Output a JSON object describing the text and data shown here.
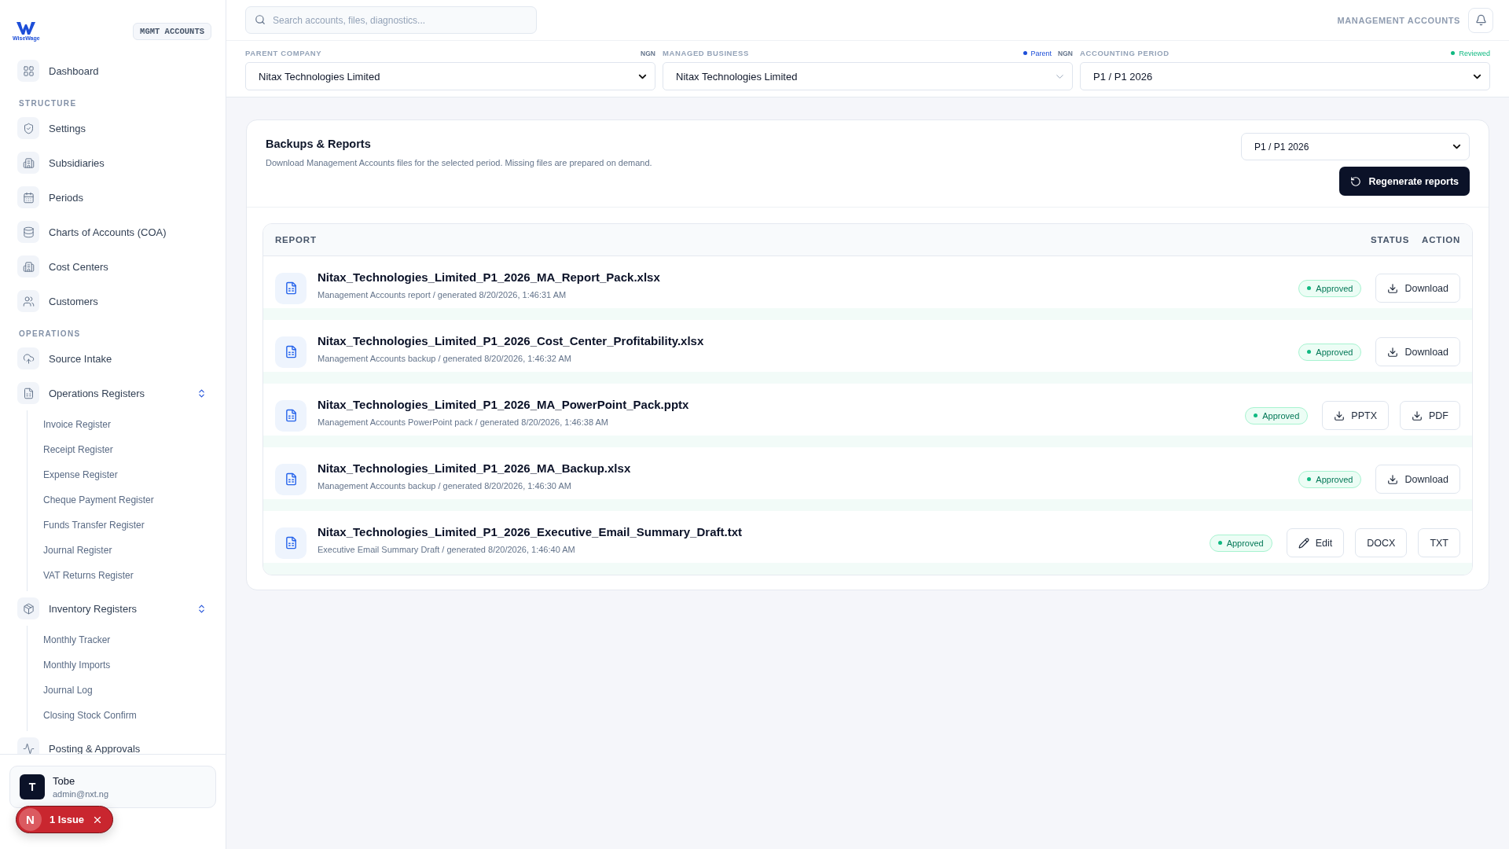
{
  "sidebar": {
    "brand": "WiseWage",
    "badge": "MGMT ACCOUNTS",
    "nav": [
      {
        "kind": "link",
        "label": "Dashboard"
      },
      {
        "kind": "heading",
        "label": "STRUCTURE"
      },
      {
        "kind": "link",
        "label": "Settings"
      },
      {
        "kind": "link",
        "label": "Subsidiaries"
      },
      {
        "kind": "link",
        "label": "Periods"
      },
      {
        "kind": "link",
        "label": "Charts of Accounts (COA)"
      },
      {
        "kind": "link",
        "label": "Cost Centers"
      },
      {
        "kind": "link",
        "label": "Customers"
      },
      {
        "kind": "heading",
        "label": "OPERATIONS"
      },
      {
        "kind": "link",
        "label": "Source Intake"
      },
      {
        "kind": "group",
        "label": "Operations Registers",
        "expanded": true,
        "children": [
          {
            "label": "Invoice Register"
          },
          {
            "label": "Receipt Register"
          },
          {
            "label": "Expense Register"
          },
          {
            "label": "Cheque Payment Register"
          },
          {
            "label": "Funds Transfer Register"
          },
          {
            "label": "Journal Register"
          },
          {
            "label": "VAT Returns Register"
          }
        ]
      },
      {
        "kind": "group",
        "label": "Inventory Registers",
        "expanded": true,
        "children": [
          {
            "label": "Monthly Tracker"
          },
          {
            "label": "Monthly Imports"
          },
          {
            "label": "Journal Log"
          },
          {
            "label": "Closing Stock Confirm"
          }
        ]
      },
      {
        "kind": "link",
        "label": "Posting & Approvals"
      }
    ],
    "user": {
      "initial": "T",
      "name": "Tobe",
      "email": "admin@nxt.ng"
    }
  },
  "toast": {
    "initial": "N",
    "label": "1 Issue"
  },
  "topbar": {
    "search": {
      "placeholder": "Search accounts, files, diagnostics..."
    },
    "title": "MANAGEMENT ACCOUNTS"
  },
  "selectors": [
    {
      "kind": "native",
      "label": "PARENT COMPANY",
      "tags": [
        {
          "text": "NGN"
        }
      ],
      "value": "Nitax Technologies Limited"
    },
    {
      "kind": "custom",
      "label": "MANAGED BUSINESS",
      "tags": [
        {
          "text": "Parent",
          "color": "#1d4ed8"
        },
        {
          "text": "NGN"
        }
      ],
      "value": "Nitax Technologies Limited"
    },
    {
      "kind": "native",
      "label": "ACCOUNTING PERIOD",
      "tags": [
        {
          "text": "Reviewed",
          "color": "#10b981"
        }
      ],
      "value": "P1 / P1 2026"
    }
  ],
  "backups": {
    "title": "Backups & Reports",
    "subtitle": "Download Management Accounts files for the selected period. Missing files are prepared on demand.",
    "period": "P1 / P1 2026",
    "regenerate": "Regenerate reports",
    "columns": [
      "REPORT",
      "STATUS",
      "ACTION"
    ],
    "rows": [
      {
        "name": "Nitax_Technologies_Limited_P1_2026_MA_Report_Pack.xlsx",
        "description": "Management Accounts report / generated 8/20/2026, 1:46:31 AM",
        "status": "Approved",
        "actions": [
          {
            "kind": "download",
            "label": "Download"
          }
        ]
      },
      {
        "name": "Nitax_Technologies_Limited_P1_2026_Cost_Center_Profitability.xlsx",
        "description": "Management Accounts backup / generated 8/20/2026, 1:46:32 AM",
        "status": "Approved",
        "actions": [
          {
            "kind": "download",
            "label": "Download"
          }
        ]
      },
      {
        "name": "Nitax_Technologies_Limited_P1_2026_MA_PowerPoint_Pack.pptx",
        "description": "Management Accounts PowerPoint pack / generated 8/20/2026, 1:46:38 AM",
        "status": "Approved",
        "actions": [
          {
            "kind": "download",
            "label": "PPTX"
          },
          {
            "kind": "download",
            "label": "PDF"
          }
        ]
      },
      {
        "name": "Nitax_Technologies_Limited_P1_2026_MA_Backup.xlsx",
        "description": "Management Accounts backup / generated 8/20/2026, 1:46:30 AM",
        "status": "Approved",
        "actions": [
          {
            "kind": "download",
            "label": "Download"
          }
        ]
      },
      {
        "name": "Nitax_Technologies_Limited_P1_2026_Executive_Email_Summary_Draft.txt",
        "description": "Executive Email Summary Draft / generated 8/20/2026, 1:46:40 AM",
        "status": "Approved",
        "actions": [
          {
            "kind": "edit",
            "label": "Edit"
          },
          {
            "kind": "plain",
            "label": "DOCX"
          },
          {
            "kind": "plain",
            "label": "TXT"
          }
        ]
      }
    ]
  }
}
